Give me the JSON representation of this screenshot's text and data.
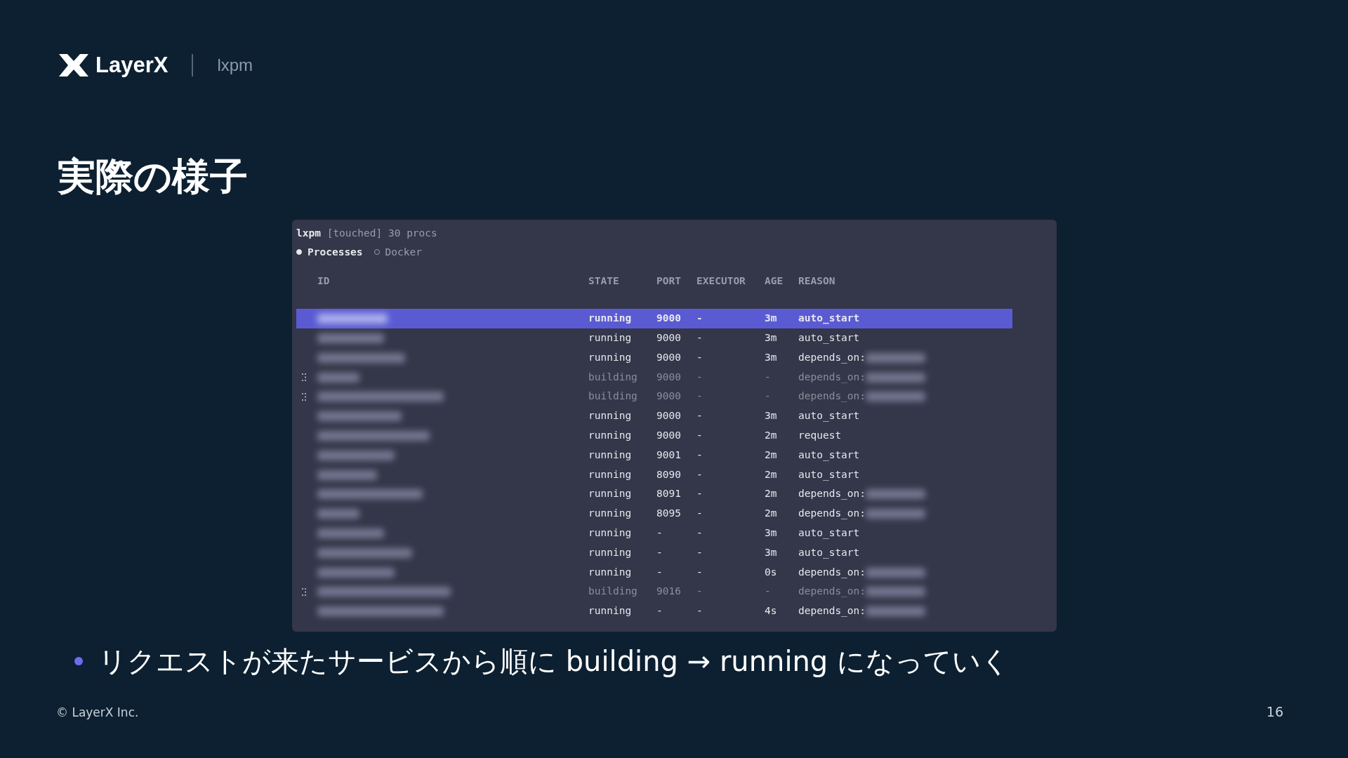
{
  "header": {
    "brand": "LayerX",
    "product": "lxpm"
  },
  "title": "実際の様子",
  "terminal": {
    "app": "lxpm",
    "status": "[touched] 30 procs",
    "tabs": [
      {
        "label": "Processes",
        "selected": true
      },
      {
        "label": "Docker",
        "selected": false
      }
    ],
    "columns": [
      "ID",
      "STATE",
      "PORT",
      "EXECUTOR",
      "AGE",
      "REASON"
    ],
    "rows": [
      {
        "selected": true,
        "dimmed": false,
        "state": "running",
        "port": "9000",
        "executor": "-",
        "age": "3m",
        "reason": "auto_start",
        "target_redacted": false
      },
      {
        "selected": false,
        "dimmed": false,
        "state": "running",
        "port": "9000",
        "executor": "-",
        "age": "3m",
        "reason": "auto_start",
        "target_redacted": false
      },
      {
        "selected": false,
        "dimmed": false,
        "state": "running",
        "port": "9000",
        "executor": "-",
        "age": "3m",
        "reason": "depends_on:",
        "target_redacted": true
      },
      {
        "selected": false,
        "dimmed": true,
        "state": "building",
        "port": "9000",
        "executor": "-",
        "age": "-",
        "reason": "depends_on:",
        "target_redacted": true
      },
      {
        "selected": false,
        "dimmed": true,
        "state": "building",
        "port": "9000",
        "executor": "-",
        "age": "-",
        "reason": "depends_on:",
        "target_redacted": true
      },
      {
        "selected": false,
        "dimmed": false,
        "state": "running",
        "port": "9000",
        "executor": "-",
        "age": "3m",
        "reason": "auto_start",
        "target_redacted": false
      },
      {
        "selected": false,
        "dimmed": false,
        "state": "running",
        "port": "9000",
        "executor": "-",
        "age": "2m",
        "reason": "request",
        "target_redacted": false
      },
      {
        "selected": false,
        "dimmed": false,
        "state": "running",
        "port": "9001",
        "executor": "-",
        "age": "2m",
        "reason": "auto_start",
        "target_redacted": false
      },
      {
        "selected": false,
        "dimmed": false,
        "state": "running",
        "port": "8090",
        "executor": "-",
        "age": "2m",
        "reason": "auto_start",
        "target_redacted": false
      },
      {
        "selected": false,
        "dimmed": false,
        "state": "running",
        "port": "8091",
        "executor": "-",
        "age": "2m",
        "reason": "depends_on:",
        "target_redacted": true
      },
      {
        "selected": false,
        "dimmed": false,
        "state": "running",
        "port": "8095",
        "executor": "-",
        "age": "2m",
        "reason": "depends_on:",
        "target_redacted": true
      },
      {
        "selected": false,
        "dimmed": false,
        "state": "running",
        "port": "-",
        "executor": "-",
        "age": "3m",
        "reason": "auto_start",
        "target_redacted": false
      },
      {
        "selected": false,
        "dimmed": false,
        "state": "running",
        "port": "-",
        "executor": "-",
        "age": "3m",
        "reason": "auto_start",
        "target_redacted": false
      },
      {
        "selected": false,
        "dimmed": false,
        "state": "running",
        "port": "-",
        "executor": "-",
        "age": "0s",
        "reason": "depends_on:",
        "target_redacted": true
      },
      {
        "selected": false,
        "dimmed": true,
        "state": "building",
        "port": "9016",
        "executor": "-",
        "age": "-",
        "reason": "depends_on:",
        "target_redacted": true
      },
      {
        "selected": false,
        "dimmed": false,
        "state": "running",
        "port": "-",
        "executor": "-",
        "age": "4s",
        "reason": "depends_on:",
        "target_redacted": true
      }
    ]
  },
  "bullets": [
    "リクエストが来たサービスから順に building → running になっていく"
  ],
  "footer": {
    "copyright": "© LayerX Inc.",
    "page": "16"
  }
}
